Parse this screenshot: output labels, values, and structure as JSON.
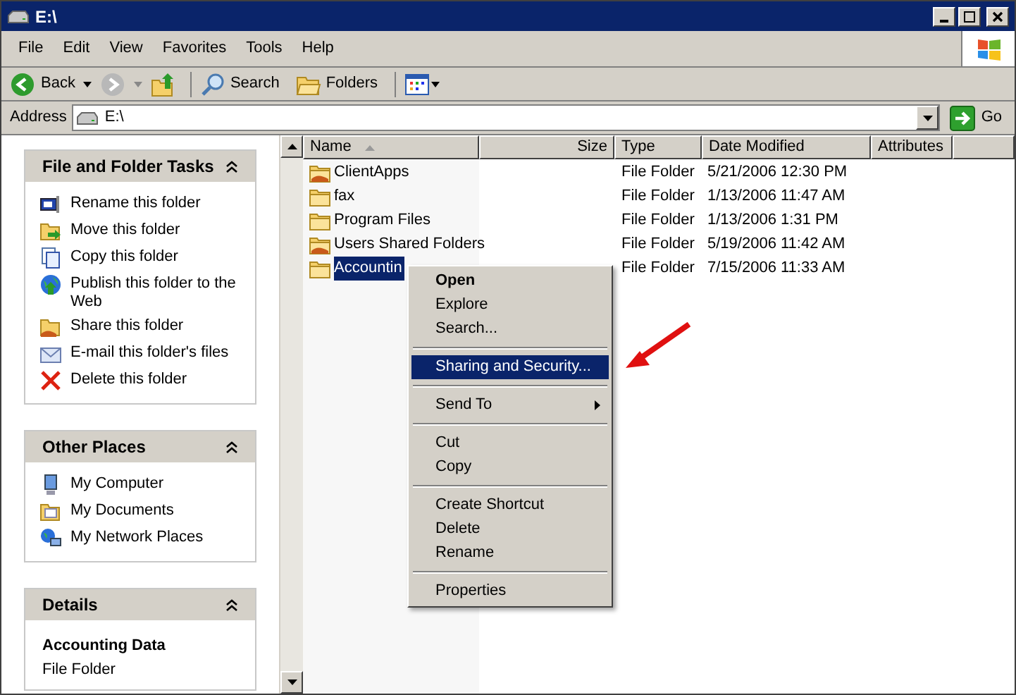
{
  "window": {
    "title": "E:\\"
  },
  "menu": [
    "File",
    "Edit",
    "View",
    "Favorites",
    "Tools",
    "Help"
  ],
  "toolbar": {
    "back": "Back",
    "search": "Search",
    "folders": "Folders"
  },
  "address": {
    "label": "Address",
    "value": "E:\\",
    "go": "Go"
  },
  "sidebar": [
    {
      "title": "File and Folder Tasks",
      "expanded": true,
      "items": [
        "Rename this folder",
        "Move this folder",
        "Copy this folder",
        "Publish this folder to the Web",
        "Share this folder",
        "E-mail this folder's files",
        "Delete this folder"
      ]
    },
    {
      "title": "Other Places",
      "expanded": true,
      "items": [
        "My Computer",
        "My Documents",
        "My Network Places"
      ]
    }
  ],
  "details": {
    "title": "Details",
    "name": "Accounting Data",
    "type": "File Folder"
  },
  "table": {
    "columns": [
      "Name",
      "Size",
      "Type",
      "Date Modified",
      "Attributes"
    ],
    "rows": [
      {
        "name": "ClientApps",
        "shared": true,
        "type": "File Folder",
        "date": "5/21/2006 12:30 PM",
        "selected": false
      },
      {
        "name": "fax",
        "shared": false,
        "type": "File Folder",
        "date": "1/13/2006 11:47 AM",
        "selected": false
      },
      {
        "name": "Program Files",
        "shared": false,
        "type": "File Folder",
        "date": "1/13/2006 1:31 PM",
        "selected": false
      },
      {
        "name": "Users Shared Folders",
        "shared": true,
        "type": "File Folder",
        "date": "5/19/2006 11:42 AM",
        "selected": false
      },
      {
        "name": "Accountin",
        "shared": false,
        "type": "File Folder",
        "date": "7/15/2006 11:33 AM",
        "selected": true
      }
    ]
  },
  "context_menu": [
    {
      "kind": "item",
      "label": "Open",
      "bold": true,
      "selected": false
    },
    {
      "kind": "item",
      "label": "Explore",
      "bold": false,
      "selected": false
    },
    {
      "kind": "item",
      "label": "Search...",
      "bold": false,
      "selected": false
    },
    {
      "kind": "separator"
    },
    {
      "kind": "item",
      "label": "Sharing and Security...",
      "bold": false,
      "selected": true
    },
    {
      "kind": "separator"
    },
    {
      "kind": "submenu",
      "label": "Send To",
      "bold": false,
      "selected": false
    },
    {
      "kind": "separator"
    },
    {
      "kind": "item",
      "label": "Cut",
      "bold": false,
      "selected": false
    },
    {
      "kind": "item",
      "label": "Copy",
      "bold": false,
      "selected": false
    },
    {
      "kind": "separator"
    },
    {
      "kind": "item",
      "label": "Create Shortcut",
      "bold": false,
      "selected": false
    },
    {
      "kind": "item",
      "label": "Delete",
      "bold": false,
      "selected": false
    },
    {
      "kind": "item",
      "label": "Rename",
      "bold": false,
      "selected": false
    },
    {
      "kind": "separator"
    },
    {
      "kind": "item",
      "label": "Properties",
      "bold": false,
      "selected": false
    }
  ]
}
